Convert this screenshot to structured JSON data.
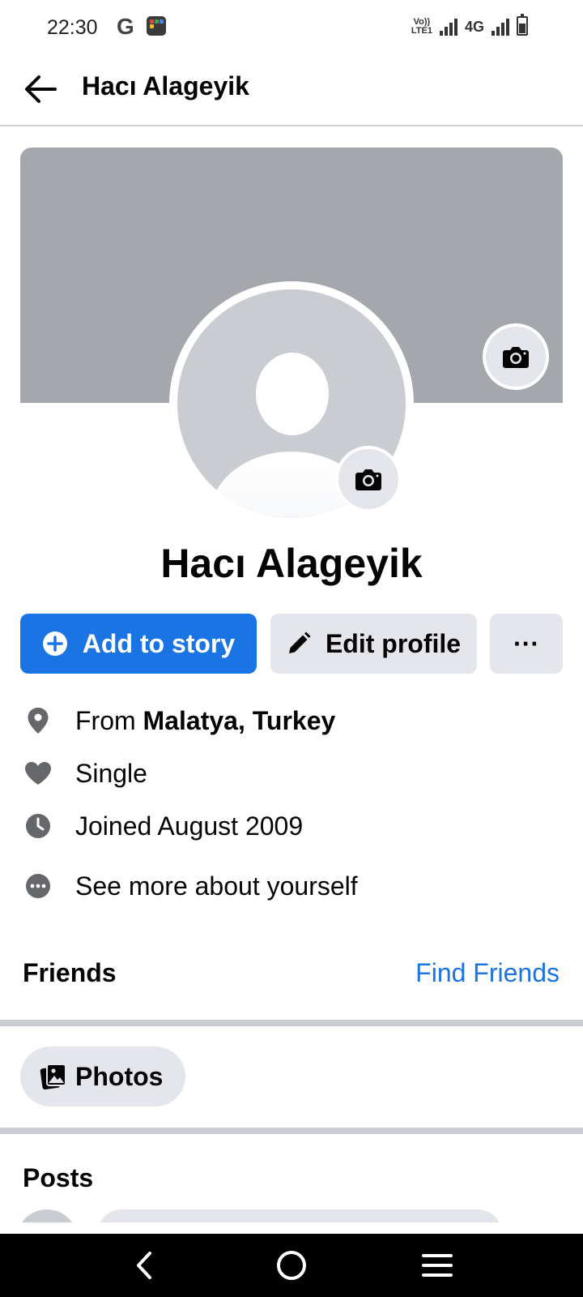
{
  "status_bar": {
    "time": "22:30",
    "google_letter": "G",
    "volte_line1": "Vo))",
    "volte_line2": "LTE1",
    "network": "4G"
  },
  "header": {
    "title": "Hacı Alageyik",
    "back_icon": "arrow-left-icon"
  },
  "profile": {
    "name": "Hacı Alageyik",
    "cover_color": "#a4a7ab",
    "avatar_color": "#c9ccd1"
  },
  "actions": {
    "add_story_label": "Add to story",
    "edit_profile_label": "Edit profile",
    "more_label": "···",
    "accent_color": "#1b74e4"
  },
  "info": {
    "from_prefix": "From ",
    "from_place": "Malatya, Turkey",
    "relationship": "Single",
    "joined": "Joined August 2009",
    "see_more": "See more about yourself"
  },
  "friends": {
    "title": "Friends",
    "find_friends_label": "Find Friends"
  },
  "photos": {
    "label": "Photos"
  },
  "posts": {
    "title": "Posts"
  },
  "navbar": {
    "back_icon": "nav-back-icon",
    "home_icon": "nav-home-icon",
    "menu_icon": "nav-menu-icon"
  }
}
